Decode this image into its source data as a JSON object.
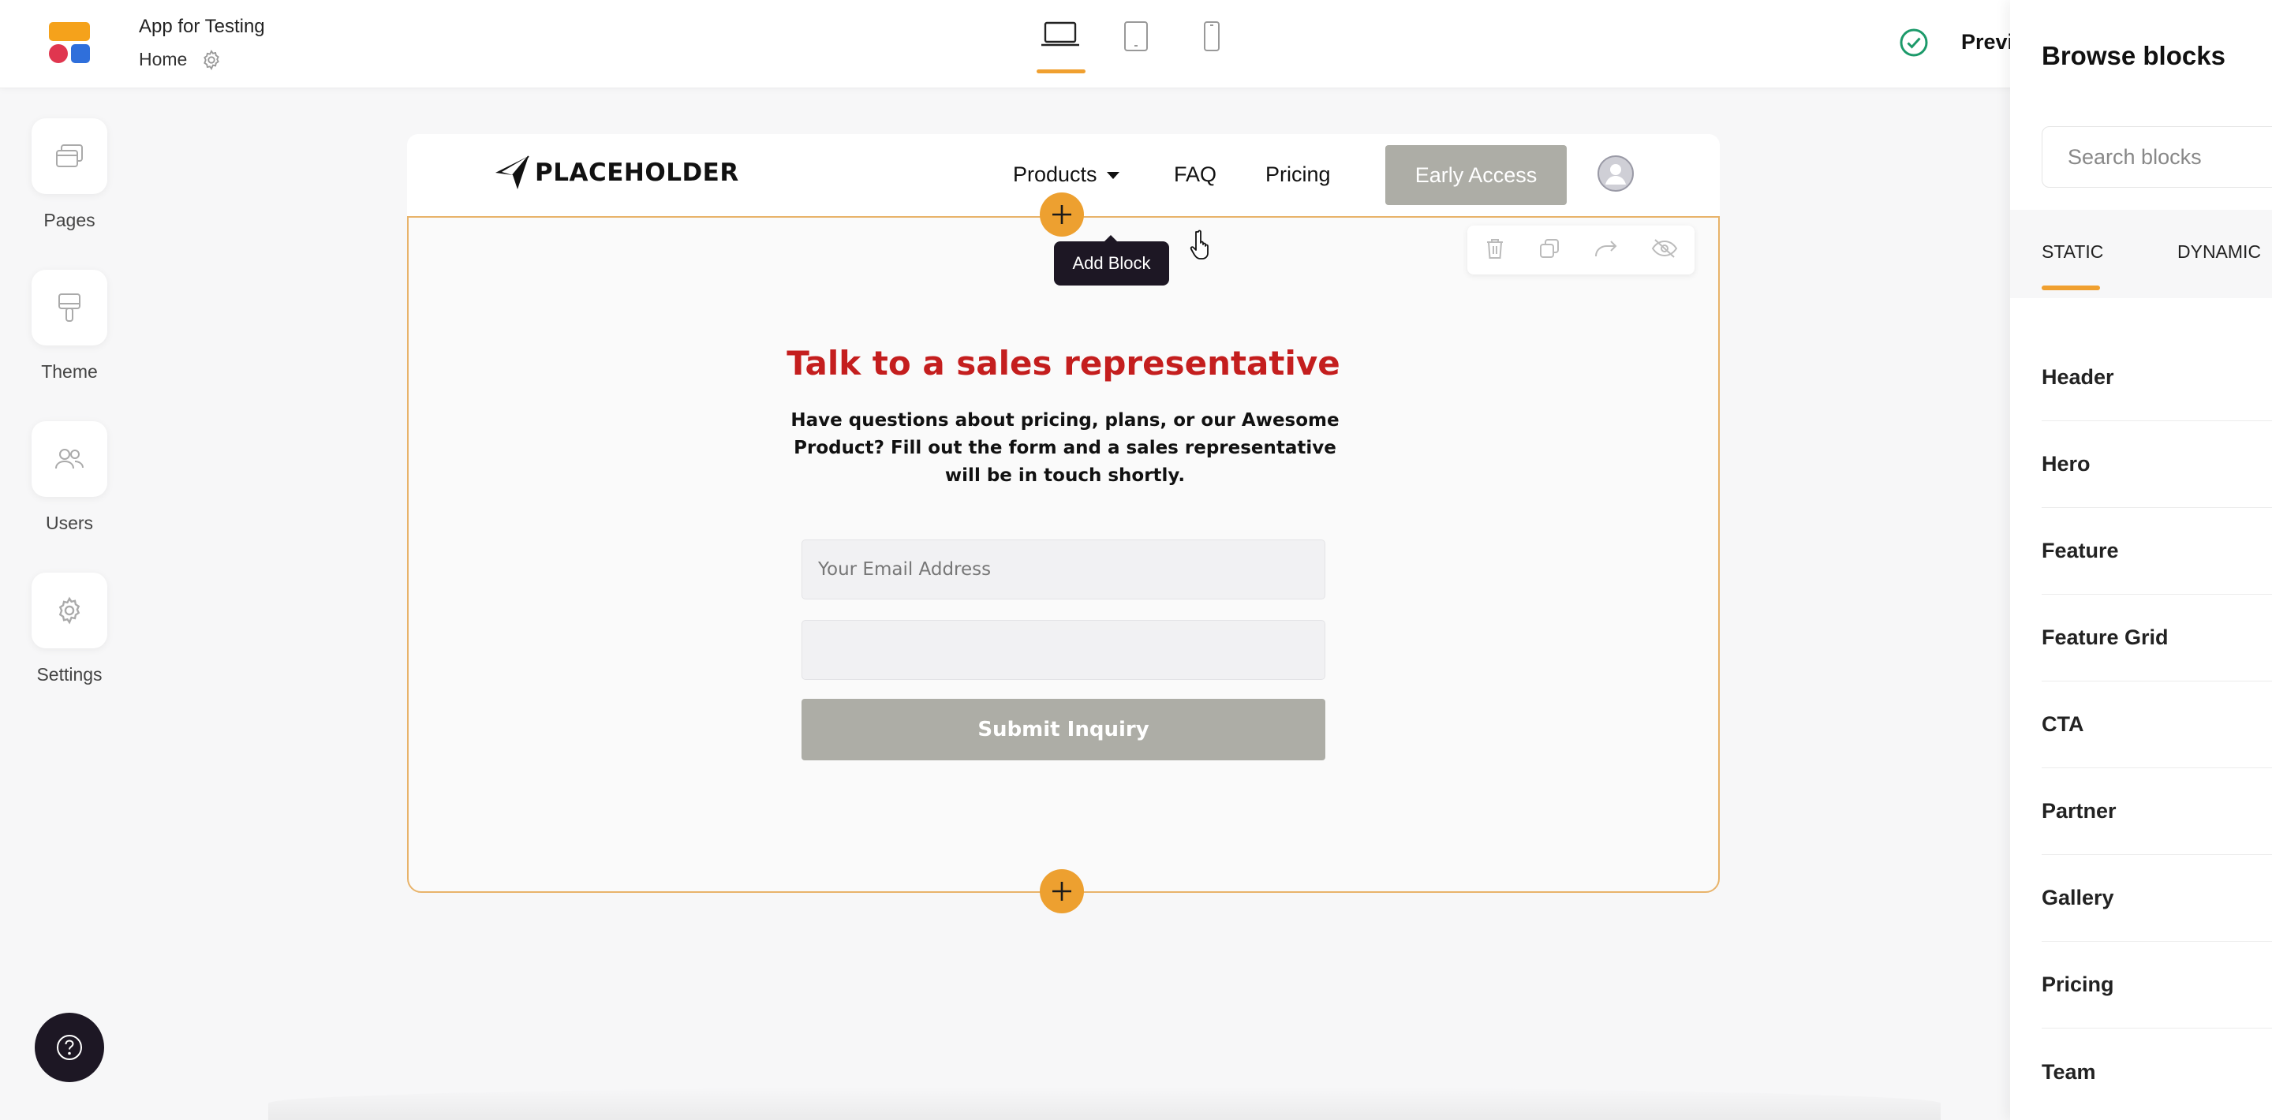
{
  "app": {
    "name": "App for Testing",
    "page": "Home",
    "status": "saved",
    "preview_label": "Previ",
    "devices": [
      "desktop",
      "tablet",
      "mobile"
    ],
    "active_device": "desktop"
  },
  "sidebar": {
    "items": [
      {
        "label": "Pages",
        "icon": "pages-icon"
      },
      {
        "label": "Theme",
        "icon": "paintbrush-icon"
      },
      {
        "label": "Users",
        "icon": "users-icon"
      },
      {
        "label": "Settings",
        "icon": "gear-icon"
      }
    ]
  },
  "site_nav": {
    "brand": "PLACEHOLDER",
    "links": [
      "Products",
      "FAQ",
      "Pricing"
    ],
    "cta": "Early Access"
  },
  "block": {
    "heading": "Talk to a sales representative",
    "subtext": "Have questions about pricing, plans, or our Awesome Product? Fill out the form and a sales representative will be in touch shortly.",
    "email_placeholder": "Your Email Address",
    "second_field_value": "",
    "submit_label": "Submit Inquiry",
    "tools": [
      "delete-icon",
      "duplicate-icon",
      "redo-icon",
      "hide-icon"
    ]
  },
  "tooltip": "Add Block",
  "panel": {
    "title": "Browse blocks",
    "search_placeholder": "Search blocks",
    "tabs": [
      "STATIC",
      "DYNAMIC"
    ],
    "active_tab": "STATIC",
    "blocks": [
      "Header",
      "Hero",
      "Feature",
      "Feature Grid",
      "CTA",
      "Partner",
      "Gallery",
      "Pricing",
      "Team"
    ]
  },
  "colors": {
    "accent": "#f0a030",
    "heading": "#c41e1e",
    "button_grey": "#adada6",
    "dark": "#1d1724"
  }
}
